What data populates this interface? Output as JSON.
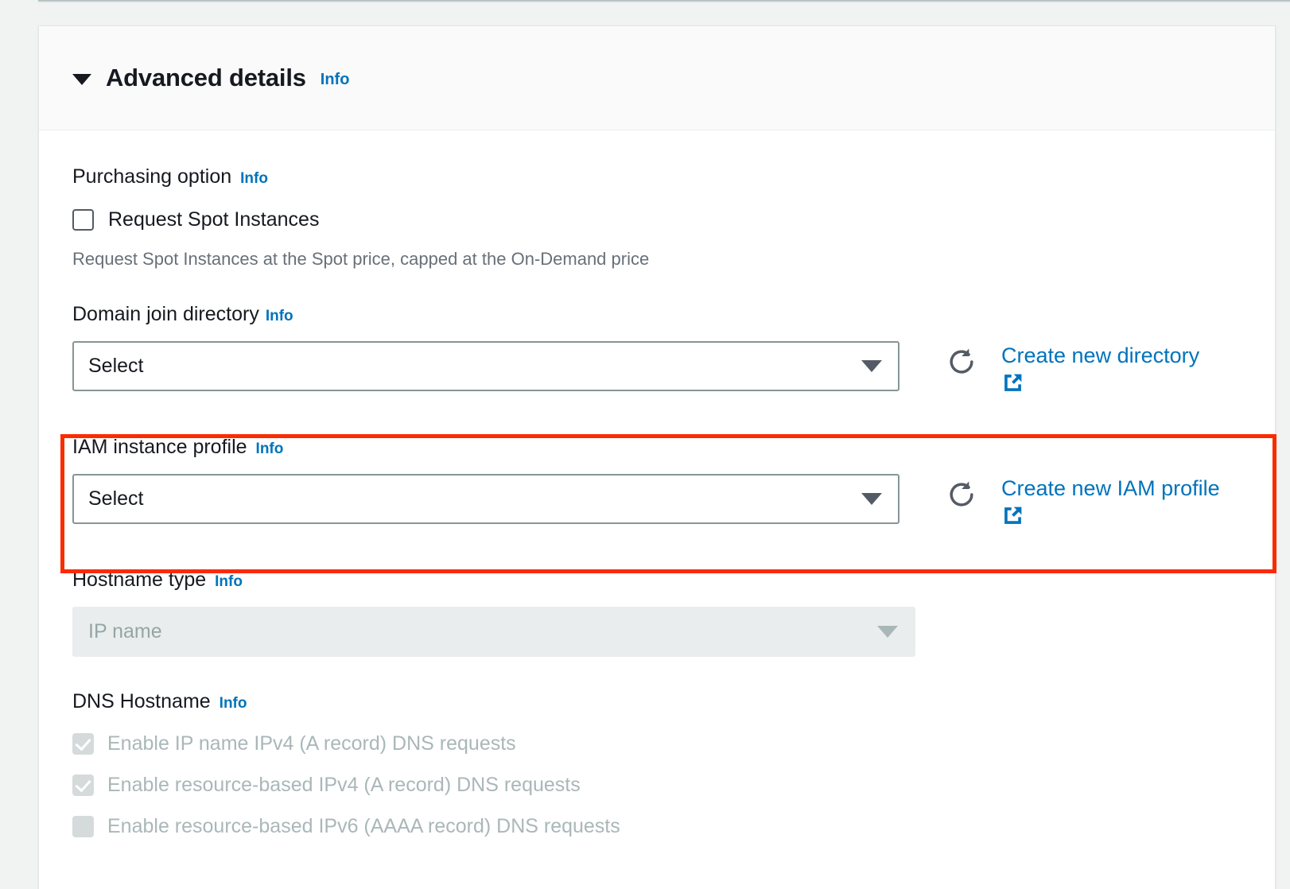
{
  "section": {
    "title": "Advanced details",
    "info_label": "Info",
    "expanded": true,
    "caret_icon": "caret-down-icon"
  },
  "purchasing_option": {
    "label": "Purchasing option",
    "info_label": "Info",
    "checkbox_label": "Request Spot Instances",
    "checked": false,
    "hint": "Request Spot Instances at the Spot price, capped at the On-Demand price"
  },
  "domain_join_directory": {
    "label": "Domain join directory",
    "info_label": "Info",
    "select_value": "Select",
    "refresh_icon": "refresh-icon",
    "create_link_label": "Create new directory",
    "external_icon": "external-link-icon"
  },
  "iam_instance_profile": {
    "label": "IAM instance profile",
    "info_label": "Info",
    "select_value": "Select",
    "refresh_icon": "refresh-icon",
    "create_link_label": "Create new IAM profile",
    "external_icon": "external-link-icon",
    "highlighted": true,
    "highlight_color": "#fa2b00"
  },
  "hostname_type": {
    "label": "Hostname type",
    "info_label": "Info",
    "select_value": "IP name",
    "disabled": true
  },
  "dns_hostname": {
    "label": "DNS Hostname",
    "info_label": "Info",
    "options": [
      {
        "label": "Enable IP name IPv4 (A record) DNS requests",
        "checked": true,
        "disabled": true
      },
      {
        "label": "Enable resource-based IPv4 (A record) DNS requests",
        "checked": true,
        "disabled": true
      },
      {
        "label": "Enable resource-based IPv6 (AAAA record) DNS requests",
        "checked": false,
        "disabled": true
      }
    ]
  },
  "colors": {
    "link": "#0073bb",
    "text": "#16191f",
    "muted": "#687078",
    "disabled": "#aab7b8",
    "highlight": "#fa2b00"
  }
}
